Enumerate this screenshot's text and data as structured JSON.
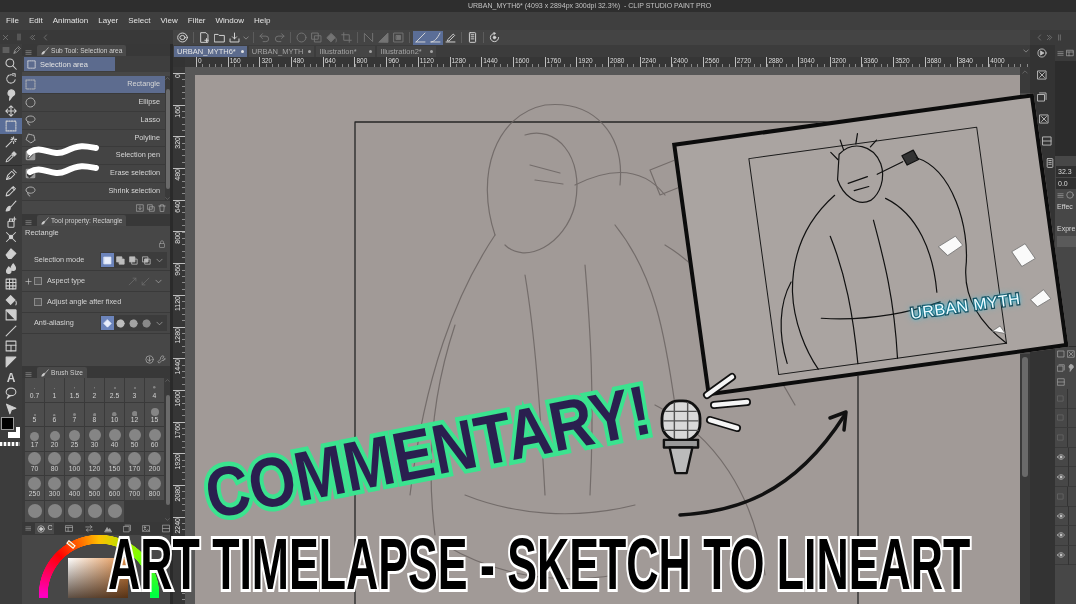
{
  "window": {
    "title": "URBAN_MYTH6* (4093 x 2894px 300dpi 32.3%)  - CLIP STUDIO PAINT PRO"
  },
  "menu": [
    "File",
    "Edit",
    "Animation",
    "Layer",
    "Select",
    "View",
    "Filter",
    "Window",
    "Help"
  ],
  "tools": [
    {
      "selected": false
    },
    {
      "selected": false
    },
    {
      "selected": false
    },
    {
      "selected": false
    },
    {
      "selected": true
    },
    {
      "selected": false
    },
    {
      "selected": false
    },
    {
      "selected": false
    },
    {
      "selected": false
    },
    {
      "selected": false
    },
    {
      "selected": false
    },
    {
      "selected": false
    },
    {
      "selected": false
    },
    {
      "selected": false
    },
    {
      "selected": false
    },
    {
      "selected": false
    },
    {
      "selected": false
    },
    {
      "selected": false
    },
    {
      "selected": false
    },
    {
      "selected": false
    },
    {
      "selected": false,
      "glyph": "A"
    },
    {
      "selected": false
    },
    {
      "selected": false
    }
  ],
  "command_bar": [
    {
      "selected": false,
      "disabled": false
    },
    {
      "selected": false,
      "disabled": false
    },
    {
      "selected": false,
      "disabled": false
    },
    {
      "selected": false,
      "disabled": false
    },
    {
      "selected": false,
      "disabled": true
    },
    {
      "selected": false,
      "disabled": true
    },
    {
      "selected": false,
      "disabled": true
    },
    {
      "selected": false,
      "disabled": true
    },
    {
      "selected": false,
      "disabled": true
    },
    {
      "selected": false,
      "disabled": true
    },
    {
      "selected": false,
      "disabled": true
    },
    {
      "selected": false,
      "disabled": true
    },
    {
      "selected": false,
      "disabled": true
    },
    {
      "selected": true,
      "disabled": false
    },
    {
      "selected": true,
      "disabled": false
    },
    {
      "selected": false,
      "disabled": false
    },
    {
      "selected": false,
      "disabled": false
    },
    {
      "selected": false,
      "disabled": false
    }
  ],
  "document_tabs": [
    {
      "label": "URBAN_MYTH6*",
      "selected": true
    },
    {
      "label": "URBAN_MYTH",
      "selected": false
    },
    {
      "label": "Illustration*",
      "selected": false
    },
    {
      "label": "Illustration2*",
      "selected": false
    }
  ],
  "rulers": {
    "horizontal": [
      "0",
      "160",
      "320",
      "480",
      "640",
      "800",
      "960",
      "1120",
      "1280",
      "1440",
      "1600",
      "1760",
      "1920",
      "2080",
      "2240",
      "2400",
      "2560",
      "2720",
      "2880",
      "3040",
      "3200",
      "3360",
      "3520",
      "3680",
      "3840",
      "4000"
    ],
    "vertical": [
      "0",
      "160",
      "320",
      "480",
      "640",
      "800",
      "960",
      "1120",
      "1280",
      "1440",
      "1600",
      "1760",
      "1920",
      "2080",
      "2240"
    ]
  },
  "sub_tool_panel": {
    "title": "Sub Tool: Selection area",
    "group": "Selection area",
    "items": [
      {
        "label": "Rectangle",
        "selected": true
      },
      {
        "label": "Ellipse",
        "selected": false
      },
      {
        "label": "Lasso",
        "selected": false
      },
      {
        "label": "Polyline",
        "selected": false
      },
      {
        "label": "Selection pen",
        "selected": false
      },
      {
        "label": "Erase selection",
        "selected": false
      },
      {
        "label": "Shrink selection",
        "selected": false
      }
    ]
  },
  "tool_property_panel": {
    "title": "Tool property: Rectangle",
    "tool_name": "Rectangle",
    "properties": [
      {
        "kind": "options",
        "label": "Selection mode",
        "options": [
          {
            "selected": true
          },
          {
            "selected": false
          },
          {
            "selected": false
          },
          {
            "selected": false
          }
        ]
      },
      {
        "kind": "expandable",
        "label": "Aspect type",
        "expanded": false,
        "checked": false
      },
      {
        "kind": "checkbox",
        "label": "Adjust angle after fixed",
        "checked": false
      },
      {
        "kind": "options",
        "label": "Anti-aliasing",
        "options": [
          {
            "selected": true
          },
          {
            "selected": false
          },
          {
            "selected": false
          },
          {
            "selected": false
          }
        ]
      }
    ]
  },
  "brush_size_panel": {
    "title": "Brush Size",
    "sizes": [
      "0.7",
      "1",
      "1.5",
      "2",
      "2.5",
      "3",
      "4",
      "5",
      "6",
      "7",
      "8",
      "10",
      "12",
      "15",
      "17",
      "20",
      "25",
      "30",
      "40",
      "50",
      "60",
      "70",
      "80",
      "100",
      "120",
      "150",
      "170",
      "200",
      "250",
      "300",
      "400",
      "500",
      "600",
      "700",
      "800"
    ]
  },
  "color_panel": {
    "tab_label": "C"
  },
  "right_panel": {
    "zoom": "32.3",
    "angle": "0.0",
    "labels": [
      "Effec",
      "Expre"
    ]
  },
  "layers": [
    {
      "visible": false
    },
    {
      "visible": false
    },
    {
      "visible": false
    },
    {
      "visible": true
    },
    {
      "visible": true
    },
    {
      "visible": false
    },
    {
      "visible": true
    },
    {
      "visible": true
    },
    {
      "visible": true
    }
  ],
  "overlay": {
    "headline": "COMMENTARY!",
    "caption": "ART TIMELAPSE - SKETCH TO LINEART",
    "inset_logo": "URBAN MYTH"
  }
}
